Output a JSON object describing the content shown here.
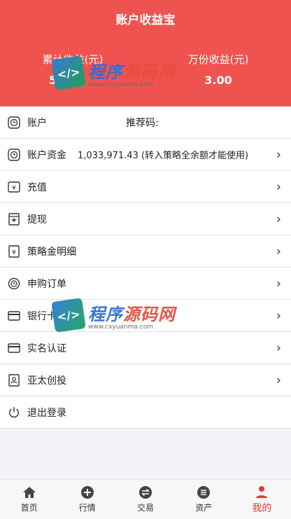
{
  "header": {
    "title": "账户收益宝",
    "cumulative_label": "累计收益(元)",
    "cumulative_value": "5",
    "per10k_label": "万份收益(元)",
    "per10k_value": "3.00",
    "accent": "#ef5350"
  },
  "account": {
    "label": "账户",
    "referral_label": "推荐码:"
  },
  "funds": {
    "label": "账户资金",
    "value": "1,033,971.43 (转入策略全余额才能使用)"
  },
  "menu": [
    {
      "label": "充值",
      "icon": "currency-exchange-icon"
    },
    {
      "label": "提现",
      "icon": "withdraw-icon"
    },
    {
      "label": "策略金明细",
      "icon": "ledger-icon"
    },
    {
      "label": "申购订单",
      "icon": "clock-icon"
    },
    {
      "label": "银行卡",
      "icon": "card-icon"
    },
    {
      "label": "实名认证",
      "icon": "card-icon"
    },
    {
      "label": "亚太创投",
      "icon": "id-card-icon"
    }
  ],
  "logout": {
    "label": "退出登录",
    "icon": "power-icon"
  },
  "watermark": {
    "name_a": "程序",
    "name_b": "源码网",
    "url": "www.cxyuanma.com",
    "badge": "</>"
  },
  "tabs": [
    {
      "label": "首页",
      "icon": "home-icon"
    },
    {
      "label": "行情",
      "icon": "plus-circle-icon"
    },
    {
      "label": "交易",
      "icon": "swap-icon"
    },
    {
      "label": "资产",
      "icon": "list-circle-icon"
    },
    {
      "label": "我的",
      "icon": "user-icon"
    }
  ],
  "colors": {
    "active_tab": "#e53935"
  }
}
